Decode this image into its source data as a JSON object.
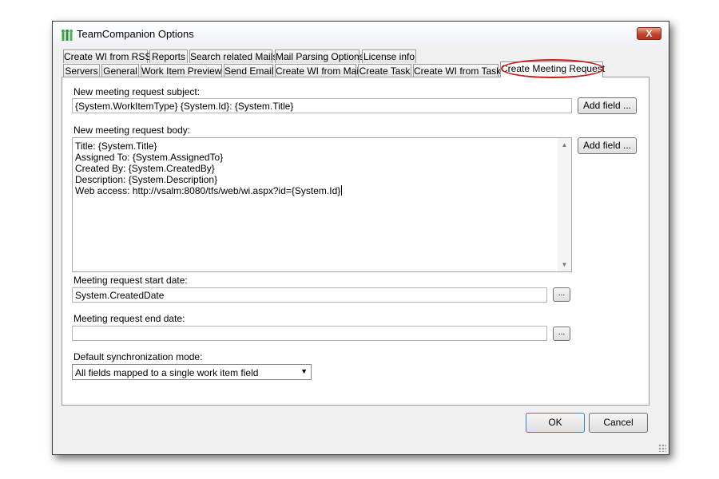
{
  "window": {
    "title": "TeamCompanion Options",
    "close_symbol": "X",
    "icon": "teamcompanion-people-icon"
  },
  "tabs": {
    "row1": [
      "Create WI from RSS",
      "Reports",
      "Search related Mails",
      "Mail Parsing Options",
      "License info"
    ],
    "row2": [
      "Servers",
      "General",
      "Work Item Preview",
      "Send Email",
      "Create WI from Mail",
      "Create Task",
      "Create WI from Task",
      "Create Meeting Request"
    ],
    "active": "Create Meeting Request"
  },
  "form": {
    "subject_label": "New meeting request subject:",
    "subject_value": "{System.WorkItemType} {System.Id}: {System.Title}",
    "add_field_label": "Add field ...",
    "body_label": "New meeting request body:",
    "body_lines": [
      "Title: {System.Title}",
      "Assigned To: {System.AssignedTo}",
      "Created By: {System.CreatedBy}",
      "Description: {System.Description}",
      "Web access: http://vsalm:8080/tfs/web/wi.aspx?id={System.Id}"
    ],
    "start_date_label": "Meeting request start date:",
    "start_date_value": "System.CreatedDate",
    "end_date_label": "Meeting request end date:",
    "end_date_value": "",
    "browse_label": "...",
    "sync_label": "Default synchronization mode:",
    "sync_value": "All fields mapped to a single work item field"
  },
  "buttons": {
    "ok": "OK",
    "cancel": "Cancel"
  },
  "colors": {
    "highlight_ring": "#c41b1b",
    "close_button": "#c7432b"
  }
}
